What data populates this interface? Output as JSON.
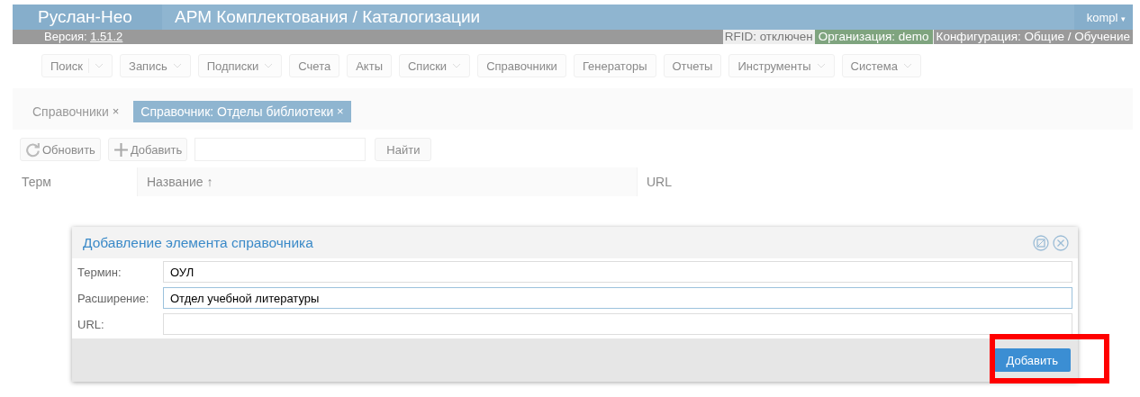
{
  "header": {
    "app_name": "Руслан-Нео",
    "title": "АРМ Комплектования / Каталогизации",
    "version_label": "Версия:",
    "version": "1.51.2",
    "user": "kompl",
    "user_caret": "▾",
    "rfid": "RFID:  отключен",
    "organization": "Организация: demo",
    "configuration": "Конфигурация: Общие / Обучение"
  },
  "menu": [
    {
      "label": "Поиск",
      "dropdown": true,
      "split": true
    },
    {
      "label": "Запись",
      "dropdown": true,
      "split": false
    },
    {
      "label": "Подписки",
      "dropdown": true,
      "split": false
    },
    {
      "label": "Счета",
      "dropdown": false,
      "split": false
    },
    {
      "label": "Акты",
      "dropdown": false,
      "split": false
    },
    {
      "label": "Списки",
      "dropdown": true,
      "split": false
    },
    {
      "label": "Справочники",
      "dropdown": false,
      "split": false
    },
    {
      "label": "Генераторы",
      "dropdown": false,
      "split": false
    },
    {
      "label": "Отчеты",
      "dropdown": false,
      "split": false
    },
    {
      "label": "Инструменты",
      "dropdown": true,
      "split": false
    },
    {
      "label": "Система",
      "dropdown": true,
      "split": false
    }
  ],
  "tabs": [
    {
      "label": "Справочники",
      "selected": false,
      "close": "×"
    },
    {
      "label": "Справочник: Отделы библиотеки",
      "selected": true,
      "close": "×"
    }
  ],
  "toolbar": {
    "refresh": "Обновить",
    "add": "Добавить",
    "find": "Найти"
  },
  "table": {
    "columns": [
      {
        "label": "Терм"
      },
      {
        "label": "Название",
        "sort": "↑"
      },
      {
        "label": "URL"
      }
    ]
  },
  "dialog": {
    "title": "Добавление элемента справочника",
    "fields": [
      {
        "label": "Термин:",
        "value": "ОУЛ",
        "focused": false
      },
      {
        "label": "Расширение:",
        "value": "Отдел учебной литературы",
        "focused": true
      },
      {
        "label": "URL:",
        "focused": false
      }
    ],
    "submit": {
      "label": "Добавить",
      "highlighted": true
    }
  }
}
